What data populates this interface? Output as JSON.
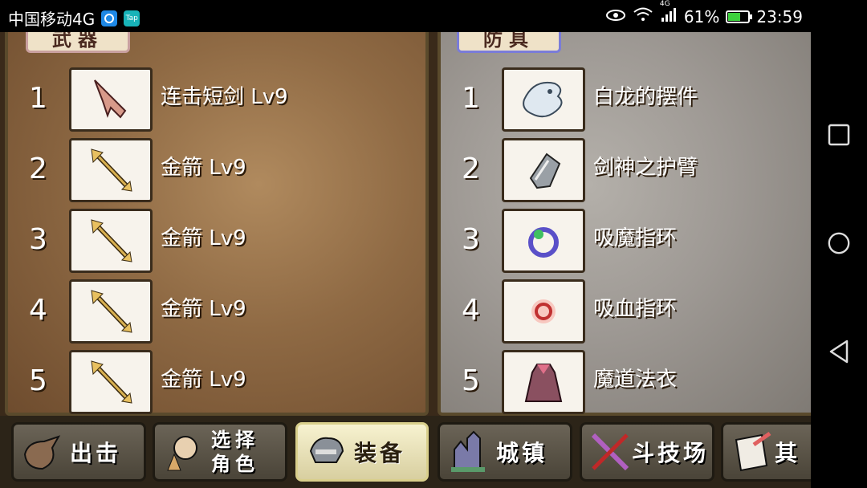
{
  "status_bar": {
    "carrier": "中国移动4G",
    "network_type": "4G",
    "battery_percent": "61%",
    "battery_level": 0.61,
    "time": "23:59",
    "app_icons": [
      "health-app-icon",
      "taptap-icon"
    ],
    "app_icon_text": [
      "",
      "Tap"
    ]
  },
  "weapons_panel": {
    "title": "武器",
    "items": [
      {
        "num": "1",
        "name": "连击短剑 Lv9",
        "icon": "dagger-icon"
      },
      {
        "num": "2",
        "name": "金箭 Lv9",
        "icon": "golden-arrow-icon"
      },
      {
        "num": "3",
        "name": "金箭 Lv9",
        "icon": "golden-arrow-icon"
      },
      {
        "num": "4",
        "name": "金箭 Lv9",
        "icon": "golden-arrow-icon"
      },
      {
        "num": "5",
        "name": "金箭 Lv9",
        "icon": "golden-arrow-icon"
      }
    ]
  },
  "armor_panel": {
    "title": "防具",
    "items": [
      {
        "num": "1",
        "name": "白龙的摆件",
        "icon": "white-dragon-ornament-icon"
      },
      {
        "num": "2",
        "name": "剑神之护臂",
        "icon": "bracer-icon"
      },
      {
        "num": "3",
        "name": "吸魔指环",
        "icon": "mana-ring-icon"
      },
      {
        "num": "4",
        "name": "吸血指环",
        "icon": "blood-ring-icon"
      },
      {
        "num": "5",
        "name": "魔道法衣",
        "icon": "magic-robe-icon"
      }
    ]
  },
  "bottom_menu": {
    "tabs": [
      {
        "label": "出击",
        "icon": "sortie-icon",
        "active": false
      },
      {
        "label": "选择角色",
        "icon": "character-select-icon",
        "active": false
      },
      {
        "label": "装备",
        "icon": "equipment-icon",
        "active": true
      },
      {
        "label": "城镇",
        "icon": "town-icon",
        "active": false
      },
      {
        "label": "斗技场",
        "icon": "arena-icon",
        "active": false
      },
      {
        "label": "其",
        "icon": "other-icon",
        "active": false
      }
    ]
  },
  "colors": {
    "weapons_bg": "#8f6a44",
    "armor_bg": "#9e9994",
    "active_tab": "#f7f2d0",
    "battery_fill": "#3dd13d"
  }
}
